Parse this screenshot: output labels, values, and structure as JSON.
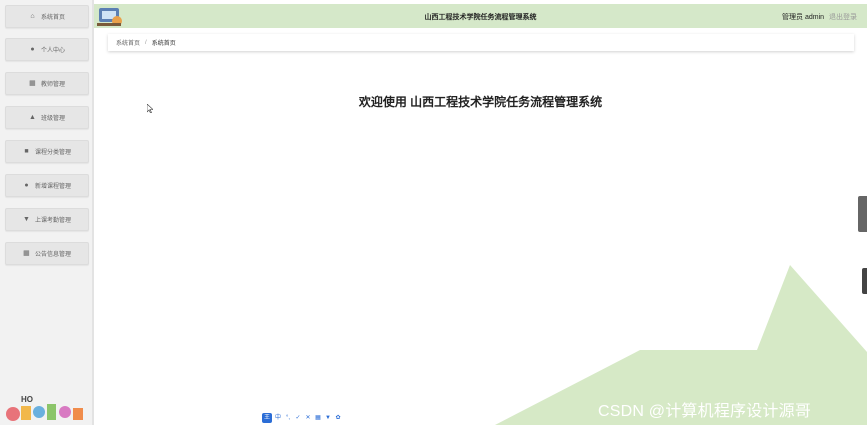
{
  "header": {
    "title": "山西工程技术学院任务流程管理系统",
    "user_label": "管理员 admin",
    "logout_label": "退出登录"
  },
  "sidebar": {
    "items": [
      {
        "label": "系统首页",
        "icon": "home-icon"
      },
      {
        "label": "个人中心",
        "icon": "user-icon"
      },
      {
        "label": "教师管理",
        "icon": "grid-icon"
      },
      {
        "label": "班级管理",
        "icon": "bank-icon"
      },
      {
        "label": "课程分类管理",
        "icon": "briefcase-icon"
      },
      {
        "label": "新增课程管理",
        "icon": "user-icon"
      },
      {
        "label": "上课考勤管理",
        "icon": "trophy-icon"
      },
      {
        "label": "公告信息管理",
        "icon": "grid-icon"
      }
    ]
  },
  "breadcrumb": {
    "root": "系统首页",
    "separator": "/",
    "current": "系统首页"
  },
  "main": {
    "welcome": "欢迎使用 山西工程技术学院任务流程管理系统"
  },
  "ime_toolbar": [
    "王",
    "中",
    "°,",
    "✓",
    "✕",
    "▦",
    "▼",
    "✿"
  ],
  "watermark": "CSDN @计算机程序设计源哥",
  "colors": {
    "header_bg": "#d5e8c9",
    "decor_green": "#d6e9c6",
    "sidebar_bg": "#f2f2f2",
    "sidebar_item_bg": "#e6e6e6"
  }
}
